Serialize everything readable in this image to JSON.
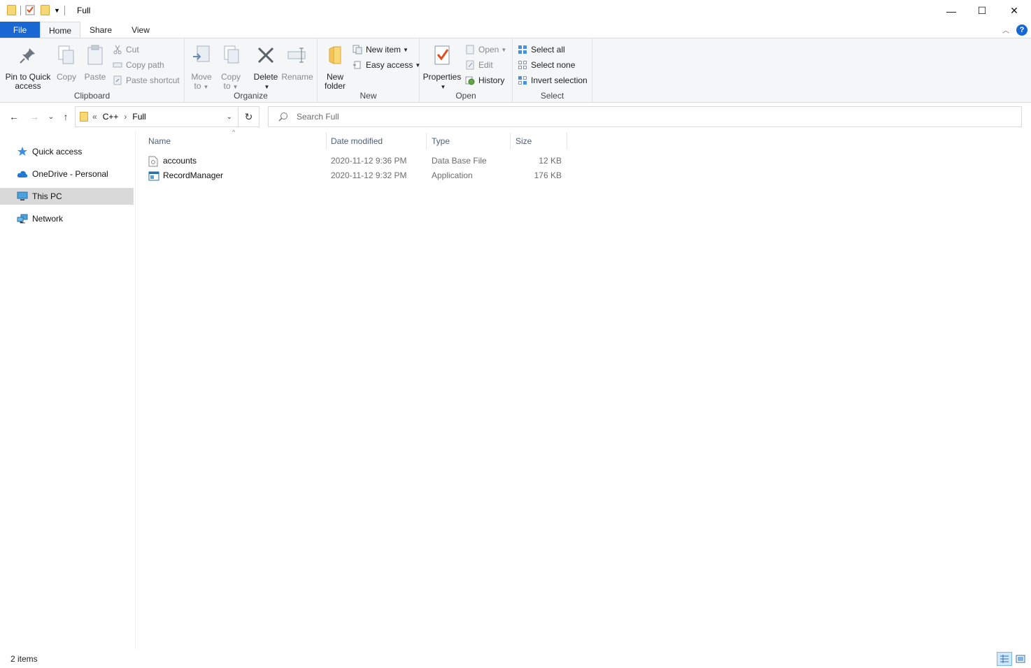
{
  "window": {
    "title": "Full",
    "controls": {
      "minimize": "—",
      "maximize": "☐",
      "close": "✕"
    }
  },
  "ribbon_tabs": {
    "file": "File",
    "home": "Home",
    "share": "Share",
    "view": "View"
  },
  "ribbon": {
    "clipboard": {
      "label": "Clipboard",
      "pin": "Pin to Quick access",
      "pin_line1": "Pin to Quick",
      "pin_line2": "access",
      "copy": "Copy",
      "paste": "Paste",
      "cut": "Cut",
      "copy_path": "Copy path",
      "paste_shortcut": "Paste shortcut"
    },
    "organize": {
      "label": "Organize",
      "move_to_1": "Move",
      "move_to_2": "to",
      "copy_to_1": "Copy",
      "copy_to_2": "to",
      "delete": "Delete",
      "rename": "Rename"
    },
    "new": {
      "label": "New",
      "new_folder_1": "New",
      "new_folder_2": "folder",
      "new_item": "New item",
      "easy_access": "Easy access"
    },
    "open": {
      "label": "Open",
      "properties": "Properties",
      "open": "Open",
      "edit": "Edit",
      "history": "History"
    },
    "select": {
      "label": "Select",
      "select_all": "Select all",
      "select_none": "Select none",
      "invert_selection": "Invert selection"
    }
  },
  "address": {
    "overflow": "«",
    "crumbs": [
      "C++",
      "Full"
    ],
    "separator": "›"
  },
  "search": {
    "placeholder": "Search Full"
  },
  "nav": {
    "items": [
      {
        "label": "Quick access"
      },
      {
        "label": "OneDrive - Personal"
      },
      {
        "label": "This PC"
      },
      {
        "label": "Network"
      }
    ]
  },
  "columns": {
    "name": "Name",
    "date": "Date modified",
    "type": "Type",
    "size": "Size"
  },
  "files": [
    {
      "name": "accounts",
      "date": "2020-11-12 9:36 PM",
      "type": "Data Base File",
      "size": "12 KB"
    },
    {
      "name": "RecordManager",
      "date": "2020-11-12 9:32 PM",
      "type": "Application",
      "size": "176 KB"
    }
  ],
  "status": {
    "count": "2 items"
  },
  "colors": {
    "accent": "#1967d2",
    "ribbon_bg": "#f5f6f7",
    "selected_nav": "#d9d9d9",
    "header_text": "#4c607a"
  }
}
